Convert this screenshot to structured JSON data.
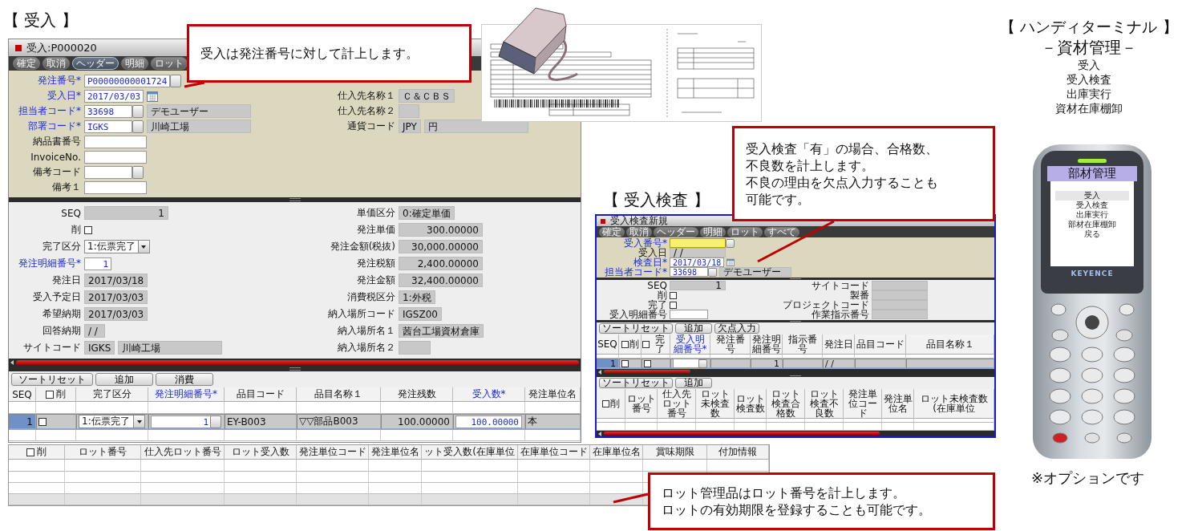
{
  "receiving": {
    "heading": "【 受入 】",
    "window": {
      "title": "受入:P000020",
      "toolbar": [
        {
          "label": "確定",
          "selected": false
        },
        {
          "label": "取消",
          "selected": false
        },
        {
          "label": "ヘッダー",
          "selected": true
        },
        {
          "label": "明細",
          "selected": false
        },
        {
          "label": "ロット",
          "selected": false
        }
      ],
      "header": {
        "left": [
          {
            "label": "発注番号*",
            "required": true,
            "kind": "lookup",
            "value": "P00000000001724"
          },
          {
            "label": "受入日*",
            "required": true,
            "kind": "date",
            "value": "2017/03/03"
          },
          {
            "label": "担当者コード*",
            "required": true,
            "kind": "lookup",
            "value": "33698",
            "name": "デモユーザー"
          },
          {
            "label": "部署コード*",
            "required": true,
            "kind": "lookup",
            "value": "IGKS",
            "name": "川崎工場"
          },
          {
            "label": "納品書番号",
            "required": false,
            "kind": "text"
          },
          {
            "label": "InvoiceNo.",
            "required": false,
            "kind": "text"
          },
          {
            "label": "備考コード",
            "required": false,
            "kind": "lookup"
          },
          {
            "label": "備考１",
            "required": false,
            "kind": "text"
          }
        ],
        "right": [
          {
            "label": "仕入先名称１",
            "required": false,
            "kind": "readonly",
            "value": "Ｃ＆ＣＢＳ"
          },
          {
            "label": "仕入先名称２",
            "required": false,
            "kind": "readonly"
          },
          {
            "label": "通貨コード",
            "required": false,
            "kind": "readonly",
            "value": "JPY",
            "name": "円"
          }
        ]
      },
      "detail": {
        "left": [
          {
            "label": "SEQ",
            "required": false,
            "kind": "number",
            "value": "1"
          },
          {
            "label": "削",
            "required": false,
            "kind": "checkbox",
            "checked": false
          },
          {
            "label": "完了区分",
            "required": false,
            "kind": "select",
            "value": "1:伝票完了"
          },
          {
            "label": "発注明細番号*",
            "required": true,
            "kind": "input",
            "value": "1"
          },
          {
            "label": "発注日",
            "required": false,
            "kind": "readonly",
            "value": "2017/03/18"
          },
          {
            "label": "受入予定日",
            "required": false,
            "kind": "readonly",
            "value": "2017/03/03"
          },
          {
            "label": "希望納期",
            "required": false,
            "kind": "readonly",
            "value": "2017/03/03"
          },
          {
            "label": "回答納期",
            "required": false,
            "kind": "readonly",
            "value": "/ /"
          },
          {
            "label": "サイトコード",
            "required": false,
            "kind": "readonly",
            "value": "IGKS",
            "name": "川崎工場"
          }
        ],
        "right": [
          {
            "label": "単価区分",
            "required": false,
            "kind": "readonly",
            "value": "0:確定単価"
          },
          {
            "label": "発注単価",
            "required": false,
            "kind": "number",
            "value": "300.00000"
          },
          {
            "label": "発注金額(税抜)",
            "required": false,
            "kind": "number",
            "value": "30,000.00000"
          },
          {
            "label": "発注税額",
            "required": false,
            "kind": "number",
            "value": "2,400.00000"
          },
          {
            "label": "発注金額",
            "required": false,
            "kind": "number",
            "value": "32,400.00000"
          },
          {
            "label": "消費税区分",
            "required": false,
            "kind": "readonly",
            "value": "1:外税"
          },
          {
            "label": "納入場所コード",
            "required": false,
            "kind": "readonly",
            "value": "IGSZ00"
          },
          {
            "label": "納入場所名１",
            "required": false,
            "kind": "readonly",
            "value": "茜台工場資材倉庫"
          },
          {
            "label": "納入場所名２",
            "required": false,
            "kind": "readonly"
          }
        ]
      },
      "lines": {
        "buttons": [
          "ソートリセット",
          "追加",
          "消費"
        ],
        "columns": [
          {
            "label": "SEQ",
            "kind": "text",
            "required": false
          },
          {
            "label": "削",
            "kind": "checkbox",
            "checked": false
          },
          {
            "label": "完了区分",
            "kind": "text",
            "required": false
          },
          {
            "label": "発注明細番号*",
            "kind": "text",
            "required": true
          },
          {
            "label": "品目コード",
            "kind": "text",
            "required": false
          },
          {
            "label": "品目名称１",
            "kind": "text",
            "required": false
          },
          {
            "label": "発注残数",
            "kind": "text",
            "required": false
          },
          {
            "label": "受入数*",
            "kind": "text",
            "required": true
          },
          {
            "label": "発注単位名",
            "kind": "text",
            "required": false
          }
        ],
        "rows": [
          {
            "selected": true,
            "cells": [
              {
                "kind": "number",
                "value": "1"
              },
              {
                "kind": "checkbox",
                "checked": false
              },
              {
                "kind": "select",
                "value": "1:伝票完了"
              },
              {
                "kind": "lookup",
                "value": "1"
              },
              {
                "kind": "text",
                "value": "EY-B003"
              },
              {
                "kind": "text",
                "value": "▽▽部品B003"
              },
              {
                "kind": "number",
                "value": "100.00000"
              },
              {
                "kind": "input",
                "value": "100.00000"
              },
              {
                "kind": "text",
                "value": "本"
              }
            ]
          }
        ]
      },
      "lots": {
        "columns": [
          {
            "label": "削",
            "kind": "checkbox",
            "checked": false
          },
          {
            "label": "ロット番号",
            "kind": "text",
            "required": false
          },
          {
            "label": "仕入先ロット番号",
            "kind": "text",
            "required": false
          },
          {
            "label": "ロット受入数",
            "kind": "text",
            "required": false
          },
          {
            "label": "発注単位コード",
            "kind": "text",
            "required": false
          },
          {
            "label": "発注単位名",
            "kind": "text",
            "required": false
          },
          {
            "label": "ット受入数(在庫単位",
            "kind": "text",
            "required": false
          },
          {
            "label": "在庫単位コード",
            "kind": "text",
            "required": false
          },
          {
            "label": "在庫単位名",
            "kind": "text",
            "required": false
          },
          {
            "label": "賞味期限",
            "kind": "text",
            "required": false
          },
          {
            "label": "付加情報",
            "kind": "text",
            "required": false
          }
        ]
      }
    }
  },
  "inspection": {
    "heading": "【 受入検査 】",
    "window": {
      "title": "受入検査新規",
      "toolbar": [
        {
          "label": "確定",
          "selected": false
        },
        {
          "label": "取消",
          "selected": false
        },
        {
          "label": "ヘッダー",
          "selected": false
        },
        {
          "label": "明細",
          "selected": false
        },
        {
          "label": "ロット",
          "selected": false
        },
        {
          "label": "すべて",
          "selected": false
        }
      ],
      "header": {
        "left": [
          {
            "label": "受入番号*",
            "required": true,
            "kind": "lookup",
            "focused": true
          },
          {
            "label": "受入日",
            "required": false,
            "kind": "readonly",
            "value": "/ /",
            "focused": false
          },
          {
            "label": "検査日*",
            "required": true,
            "kind": "date",
            "value": "2017/03/18",
            "focused": false
          },
          {
            "label": "担当者コード*",
            "required": true,
            "kind": "lookup",
            "value": "33698",
            "name": "デモユーザー",
            "focused": false
          }
        ]
      },
      "detail": {
        "left": [
          {
            "label": "SEQ",
            "required": false,
            "kind": "number",
            "value": "1"
          },
          {
            "label": "削",
            "required": false,
            "kind": "checkbox",
            "checked": false
          },
          {
            "label": "完了",
            "required": false,
            "kind": "checkbox",
            "checked": false
          },
          {
            "label": "受入明細番号",
            "required": false,
            "kind": "text"
          }
        ],
        "right": [
          {
            "label": "サイトコード",
            "required": false,
            "kind": "readonly"
          },
          {
            "label": "製番",
            "required": false,
            "kind": "readonly"
          },
          {
            "label": "プロジェクトコード",
            "required": false,
            "kind": "readonly"
          },
          {
            "label": "作業指示番号",
            "required": false,
            "kind": "readonly"
          }
        ]
      },
      "lines": {
        "buttons": [
          "ソートリセット",
          "追加",
          "欠点入力"
        ],
        "columns": [
          {
            "label": "SEQ",
            "kind": "text",
            "required": false
          },
          {
            "label": "削",
            "kind": "checkbox",
            "checked": false
          },
          {
            "label": "完了",
            "kind": "checkbox",
            "checked": false
          },
          {
            "label": "受入明細番号*",
            "kind": "text",
            "required": true
          },
          {
            "label": "発注番号",
            "kind": "text",
            "required": false
          },
          {
            "label": "発注明細番号",
            "kind": "text",
            "required": false
          },
          {
            "label": "指示番号",
            "kind": "text",
            "required": false
          },
          {
            "label": "発注日",
            "kind": "text",
            "required": false
          },
          {
            "label": "品目コード",
            "kind": "text",
            "required": false
          },
          {
            "label": "品目名称１",
            "kind": "text",
            "required": false
          }
        ],
        "rows": [
          {
            "selected": true,
            "cells": [
              {
                "kind": "number",
                "value": "1"
              },
              {
                "kind": "checkbox",
                "checked": false
              },
              {
                "kind": "checkbox",
                "checked": false
              },
              {
                "kind": "lookup"
              },
              {
                "kind": "text"
              },
              {
                "kind": "number",
                "value": "1"
              },
              {
                "kind": "text"
              },
              {
                "kind": "text",
                "value": "/ /"
              },
              {
                "kind": "text"
              },
              {
                "kind": "text"
              }
            ]
          }
        ]
      },
      "lots": {
        "buttons": [
          "ソートリセット",
          "追加"
        ],
        "columns": [
          {
            "label": "削",
            "kind": "checkbox",
            "checked": false
          },
          {
            "label": "ロット番号",
            "kind": "text",
            "required": false
          },
          {
            "label": "仕入先ロット番号",
            "kind": "text",
            "required": false
          },
          {
            "label": "ロット未検査数",
            "kind": "text",
            "required": false
          },
          {
            "label": "ロット検査数",
            "kind": "text",
            "required": false
          },
          {
            "label": "ロット検査合格数",
            "kind": "text",
            "required": false
          },
          {
            "label": "ロット検査不良数",
            "kind": "text",
            "required": false
          },
          {
            "label": "発注単位コード",
            "kind": "text",
            "required": false
          },
          {
            "label": "発注単位名",
            "kind": "text",
            "required": false
          },
          {
            "label": "ロット未検査数(在庫単位",
            "kind": "text",
            "required": false
          }
        ]
      }
    }
  },
  "terminal": {
    "heading": "【 ハンディターミナル 】",
    "subheading": "－資材管理－",
    "functions": [
      "受入",
      "受入検査",
      "出庫実行",
      "資材在庫棚卸"
    ],
    "device": {
      "screen_title": "部材管理",
      "menu": [
        {
          "label": "受入",
          "selected": true
        },
        {
          "label": "受入検査",
          "selected": false
        },
        {
          "label": "出庫実行",
          "selected": false
        },
        {
          "label": "部材在庫棚卸",
          "selected": false
        },
        {
          "label": "戻る",
          "selected": false
        }
      ],
      "brand": "KEYENCE"
    },
    "note": "※オプションです"
  },
  "callouts": [
    {
      "lines": [
        "受入は発注番号に対して計上します。"
      ]
    },
    {
      "lines": [
        "受入検査「有」の場合、合格数、",
        "不良数を計上します。",
        "不良の理由を欠点入力することも",
        "可能です。"
      ]
    },
    {
      "lines": [
        "ロット管理品はロット番号を計上します。",
        "ロットの有効期限を登録することも可能です。"
      ]
    }
  ]
}
